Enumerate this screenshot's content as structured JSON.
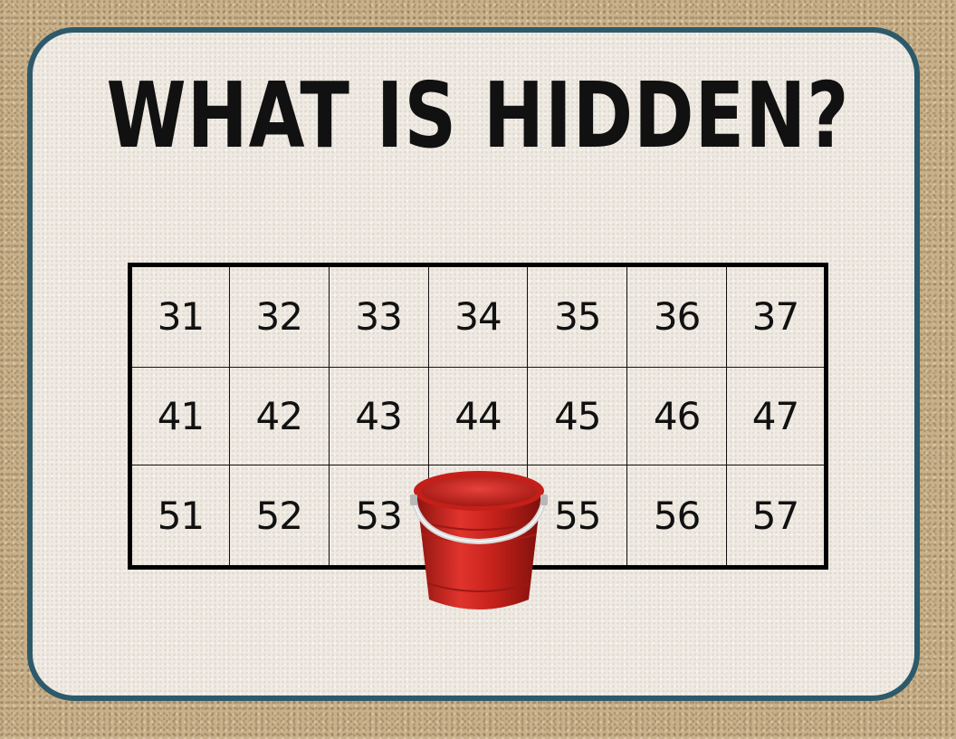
{
  "title": "WHAT IS HIDDEN?",
  "grid": {
    "rows": [
      [
        "31",
        "32",
        "33",
        "34",
        "35",
        "36",
        "37"
      ],
      [
        "41",
        "42",
        "43",
        "44",
        "45",
        "46",
        "47"
      ],
      [
        "51",
        "52",
        "53",
        "",
        "55",
        "56",
        "57"
      ]
    ]
  },
  "colors": {
    "border": "#2d5a6b",
    "card": "#efeae3",
    "sand": "#c8b08a",
    "bucket": "#d42a24"
  },
  "icons": {
    "bucket": "red-bucket-icon"
  }
}
